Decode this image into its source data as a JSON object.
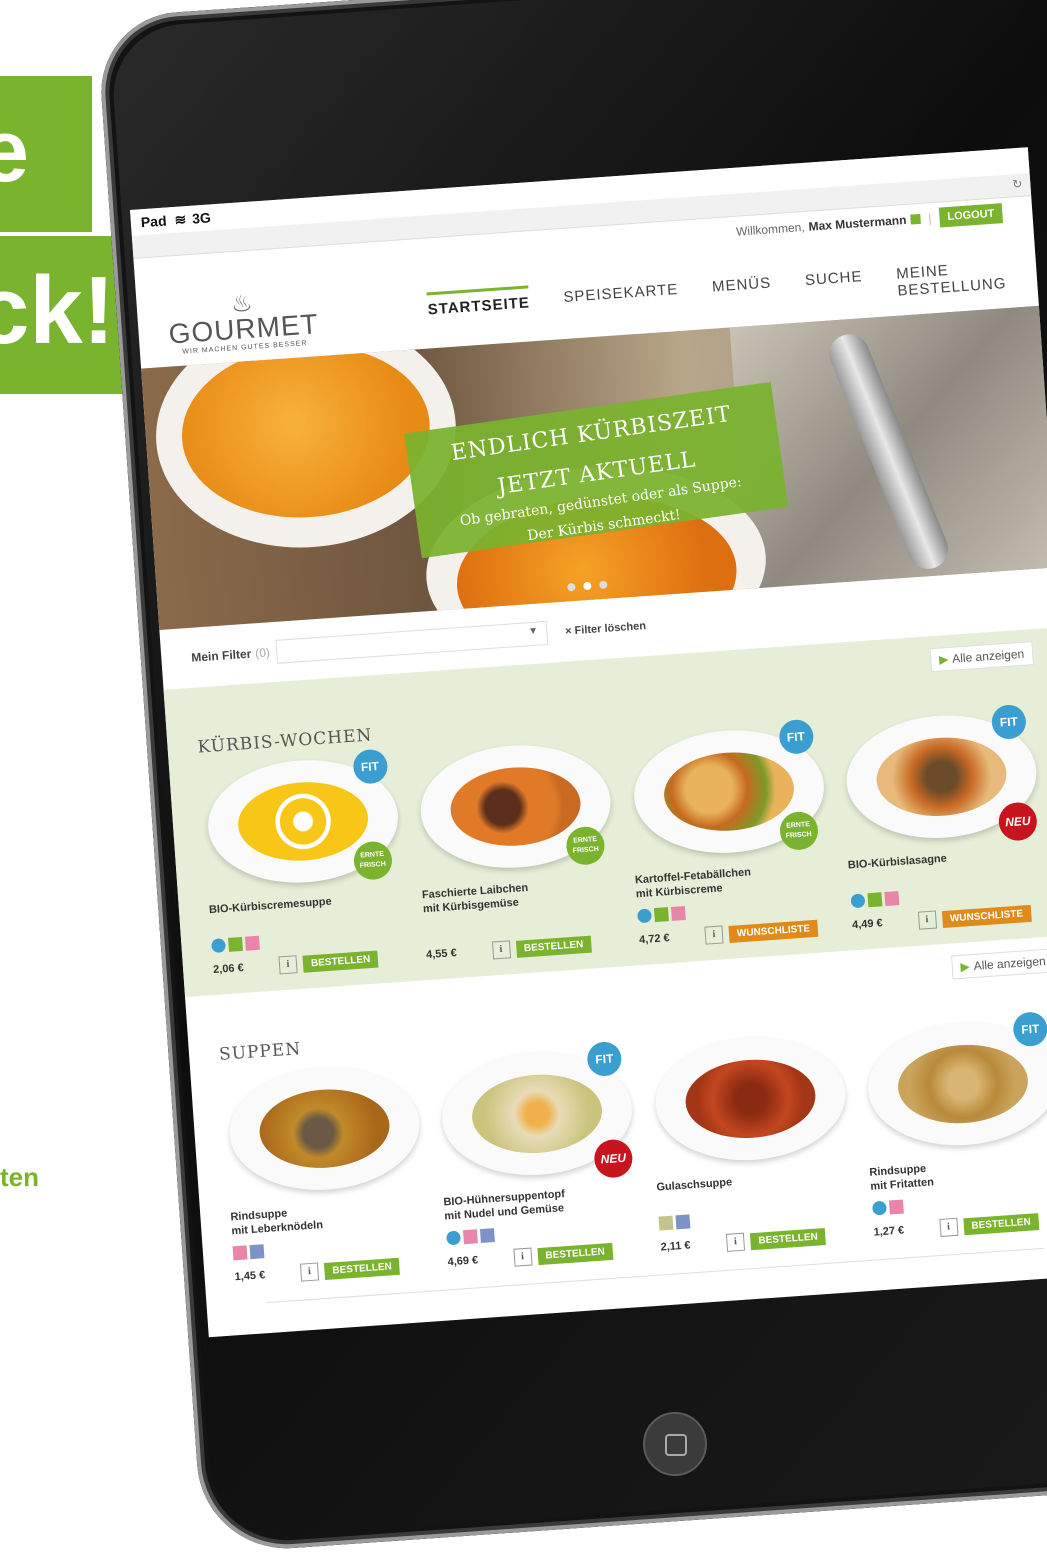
{
  "promo": {
    "line1": "e",
    "line2": "ck!",
    "side": "ten"
  },
  "device": {
    "carrier": "Pad",
    "network": "3G"
  },
  "header": {
    "welcome": "Willkommen,",
    "user": "Max Mustermann",
    "logout": "LOGOUT",
    "logo_name": "GOURMET",
    "logo_claim": "WIR MACHEN GUTES BESSER",
    "nav": [
      "STARTSEITE",
      "SPEISEKARTE",
      "MENÜS",
      "SUCHE",
      "MEINE BESTELLUNG"
    ]
  },
  "hero": {
    "title1": "ENDLICH KÜRBISZEIT",
    "title2": "JETZT AKTUELL",
    "sub1": "Ob gebraten, gedünstet oder als Suppe:",
    "sub2": "Der Kürbis schmeckt!"
  },
  "filter": {
    "label": "Mein Filter",
    "count": "(0)",
    "clear": "× Filter löschen"
  },
  "sections": [
    {
      "title": "KÜRBIS-WOCHEN",
      "all": "Alle anzeigen",
      "products": [
        {
          "name1": "BIO-Kürbiscremesuppe",
          "name2": "",
          "price": "2,06 €",
          "button": "BESTELLEN",
          "info": "i"
        },
        {
          "name1": "Faschierte Laibchen",
          "name2": "mit Kürbisgemüse",
          "price": "4,55 €",
          "button": "BESTELLEN",
          "info": "i"
        },
        {
          "name1": "Kartoffel-Fetabällchen",
          "name2": "mit Kürbiscreme",
          "price": "4,72 €",
          "button": "WUNSCHLISTE",
          "info": "i"
        },
        {
          "name1": "BIO-Kürbislasagne",
          "name2": "",
          "price": "4,49 €",
          "button": "WUNSCHLISTE",
          "info": "i"
        }
      ]
    },
    {
      "title": "SUPPEN",
      "all": "Alle anzeigen",
      "products": [
        {
          "name1": "Rindsuppe",
          "name2": "mit Leberknödeln",
          "price": "1,45 €",
          "button": "BESTELLEN",
          "info": "i"
        },
        {
          "name1": "BIO-Hühnersuppentopf",
          "name2": "mit Nudel und Gemüse",
          "price": "4,69 €",
          "button": "BESTELLEN",
          "info": "i"
        },
        {
          "name1": "Gulaschsuppe",
          "name2": "",
          "price": "2,11 €",
          "button": "BESTELLEN",
          "info": "i"
        },
        {
          "name1": "Rindsuppe",
          "name2": "mit Fritatten",
          "price": "1,27 €",
          "button": "BESTELLEN",
          "info": "i"
        }
      ]
    }
  ],
  "badges": {
    "fit": "FIT",
    "neu": "NEU",
    "ernte": "ERNTE FRISCH"
  },
  "colors": {
    "brand_green": "#7ab32e",
    "wishlist_orange": "#e08a1a",
    "neu_red": "#c8141e",
    "fit_blue": "#3a9fd0"
  }
}
